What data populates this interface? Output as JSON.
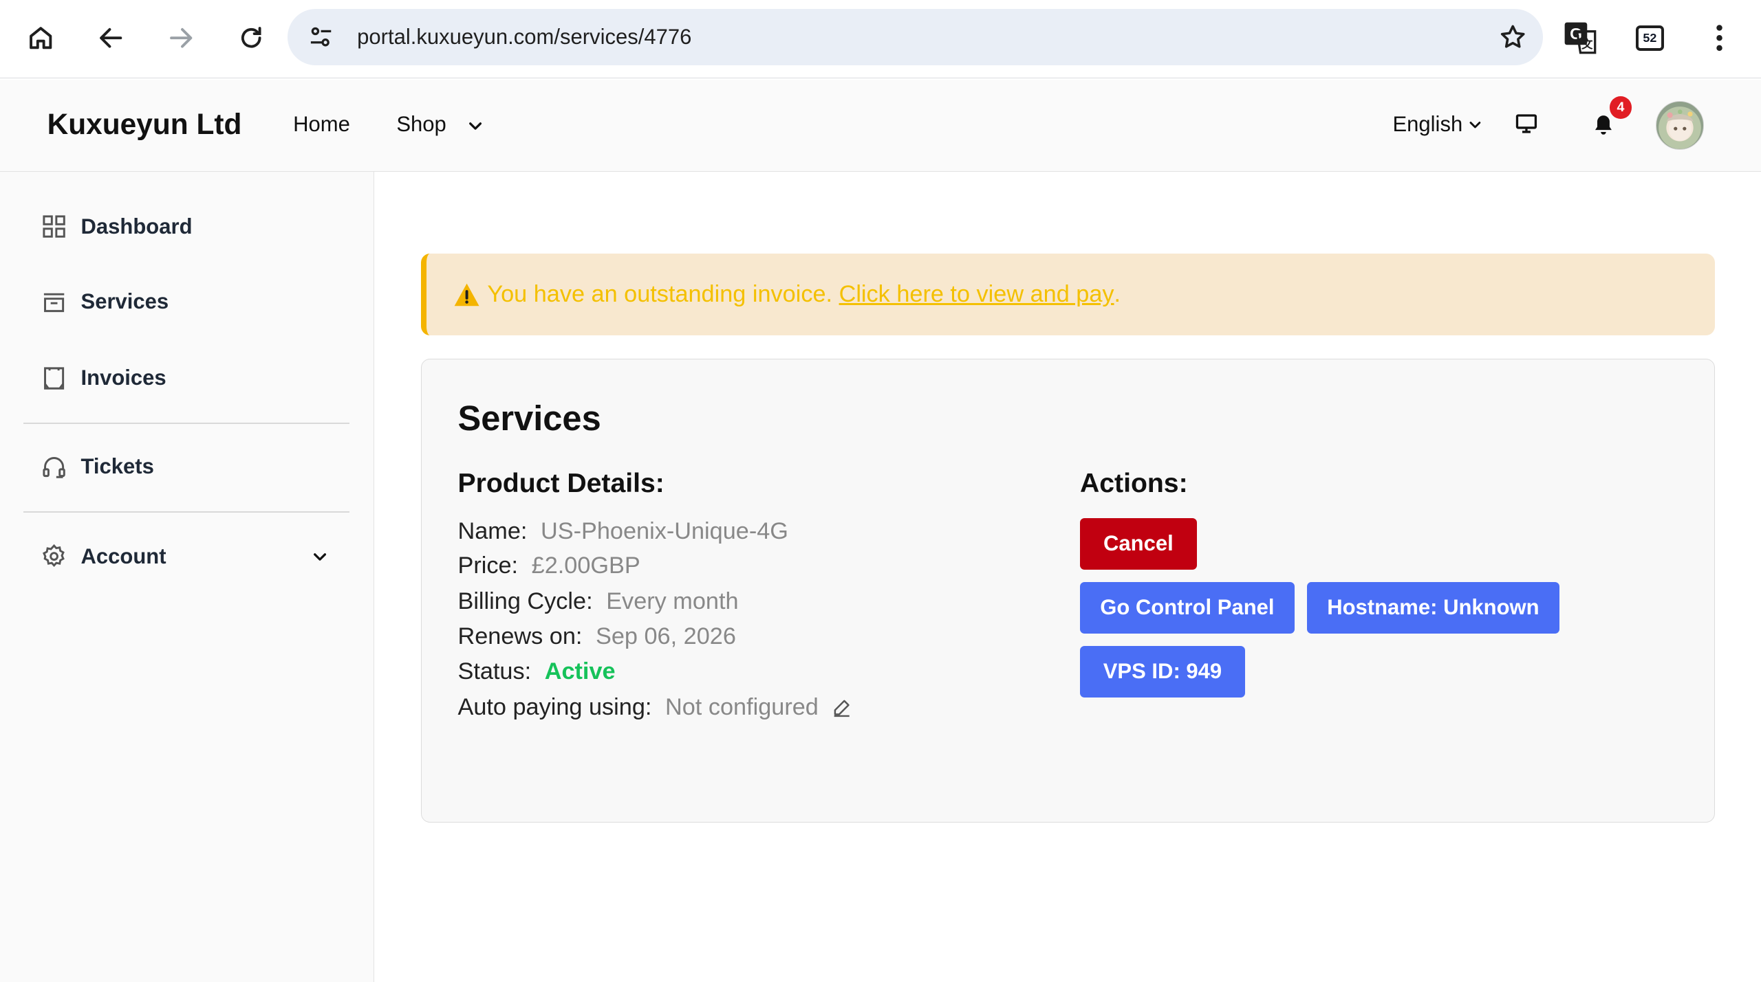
{
  "browser": {
    "url": "portal.kuxueyun.com/services/4776",
    "tab_count": "52"
  },
  "header": {
    "brand": "Kuxueyun Ltd",
    "nav_home": "Home",
    "nav_shop": "Shop",
    "language": "English",
    "notification_count": "4"
  },
  "sidebar": {
    "items": [
      {
        "label": "Dashboard"
      },
      {
        "label": "Services"
      },
      {
        "label": "Invoices"
      },
      {
        "label": "Tickets"
      },
      {
        "label": "Account"
      }
    ]
  },
  "alert": {
    "text": "You have an outstanding invoice.",
    "link": "Click here to view and pay",
    "suffix": "."
  },
  "service": {
    "title": "Services",
    "details_heading": "Product Details:",
    "details": [
      {
        "label": "Name:",
        "value": "US-Phoenix-Unique-4G"
      },
      {
        "label": "Price:",
        "value": "£2.00GBP"
      },
      {
        "label": "Billing Cycle:",
        "value": "Every month"
      },
      {
        "label": "Renews on:",
        "value": "Sep 06, 2026"
      },
      {
        "label": "Status:",
        "value": "Active"
      },
      {
        "label": "Auto paying using:",
        "value": "Not configured"
      }
    ],
    "actions_heading": "Actions:",
    "actions": {
      "cancel": "Cancel",
      "control_panel": "Go Control Panel",
      "hostname": "Hostname: Unknown",
      "vps_id": "VPS ID: 949"
    }
  },
  "colors": {
    "status_active": "#16c25a",
    "danger": "#c10010",
    "primary": "#4a6ef5",
    "warning": "#f4c000"
  }
}
